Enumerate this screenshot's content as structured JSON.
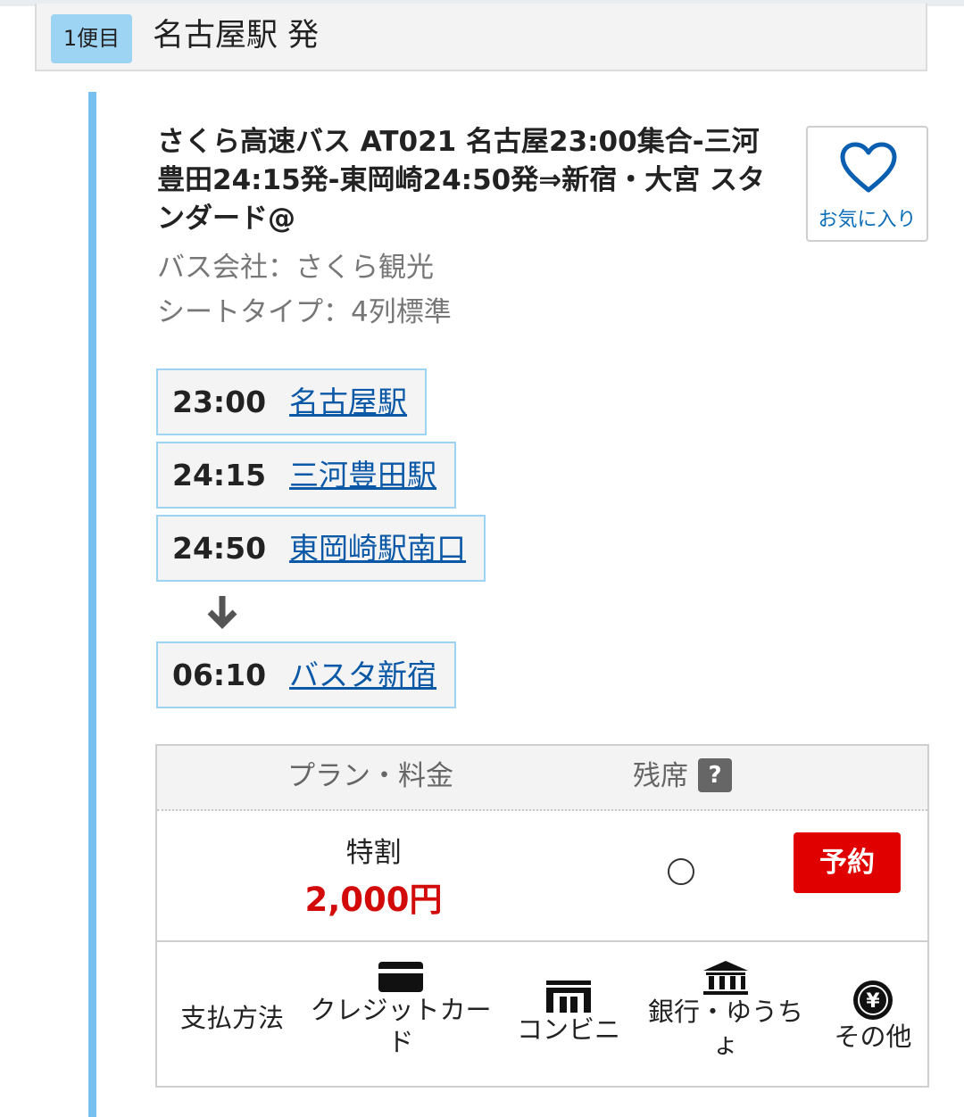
{
  "trip": {
    "badge": "1便目",
    "title": "名古屋駅 発"
  },
  "bus": {
    "name": "さくら高速バス AT021 名古屋23:00集合-三河豊田24:15発-東岡崎24:50発⇒新宿・大宮 スタンダード@",
    "company": "バス会社：さくら観光",
    "seat_type": "シートタイプ：4列標準",
    "favorite_label": "お気に入り"
  },
  "stops": [
    {
      "time": "23:00",
      "name": "名古屋駅"
    },
    {
      "time": "24:15",
      "name": "三河豊田駅"
    },
    {
      "time": "24:50",
      "name": "東岡崎駅南口"
    },
    {
      "time": "06:10",
      "name": "バスタ新宿"
    }
  ],
  "plan_table": {
    "col_plan": "プラン・料金",
    "col_seats": "残席",
    "help": "?",
    "plan_name": "特割",
    "price": "2,000円",
    "reserve_label": "予約",
    "payment_label": "支払方法",
    "payment_methods": [
      {
        "line1": "クレジットカー",
        "line2": "ド",
        "icon": "credit-card-icon"
      },
      {
        "line1": "コンビニ",
        "line2": "",
        "icon": "convenience-store-icon"
      },
      {
        "line1": "銀行・ゆうち",
        "line2": "ょ",
        "icon": "bank-icon"
      },
      {
        "line1": "その他",
        "line2": "",
        "icon": "yen-coin-icon"
      }
    ]
  },
  "colors": {
    "accent_blue": "#78c0ef",
    "link_blue": "#0b58a6",
    "price_red": "#d20a0a",
    "reserve_red": "#e00000"
  }
}
